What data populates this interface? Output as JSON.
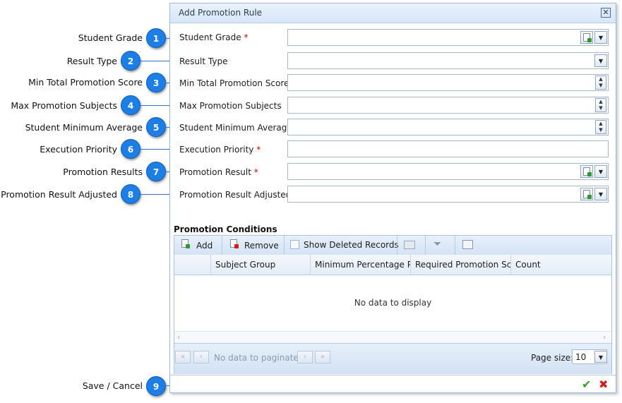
{
  "dialog": {
    "title": "Add Promotion Rule",
    "close_label": "✕"
  },
  "callouts": [
    {
      "num": "1",
      "label": "Student Grade"
    },
    {
      "num": "2",
      "label": "Result  Type"
    },
    {
      "num": "3",
      "label": "Min Total Promotion Score"
    },
    {
      "num": "4",
      "label": "Max Promotion Subjects"
    },
    {
      "num": "5",
      "label": "Student Minimum Average"
    },
    {
      "num": "6",
      "label": "Execution Priority"
    },
    {
      "num": "7",
      "label": "Promotion Results"
    },
    {
      "num": "8",
      "label": "Promotion Result Adjusted"
    },
    {
      "num": "9",
      "label": "Save / Cancel"
    }
  ],
  "fields": [
    {
      "label": "Student Grade",
      "required": "*",
      "value": ""
    },
    {
      "label": "Result Type",
      "required": "",
      "value": ""
    },
    {
      "label": "Min Total Promotion Score",
      "required": "",
      "value": ""
    },
    {
      "label": "Max Promotion Subjects",
      "required": "",
      "value": ""
    },
    {
      "label": "Student Minimum Average",
      "required": "",
      "value": ""
    },
    {
      "label": "Execution Priority",
      "required": "*",
      "value": ""
    },
    {
      "label": "Promotion Result",
      "required": "*",
      "value": ""
    },
    {
      "label": "Promotion Result Adjusted",
      "required": "",
      "value": ""
    }
  ],
  "conditions": {
    "title": "Promotion Conditions",
    "toolbar": {
      "add": "Add",
      "remove": "Remove",
      "show_deleted": "Show Deleted Records"
    },
    "columns": [
      "Subject Group",
      "Minimum Percentage Per",
      "Required Promotion Scor",
      "Count"
    ],
    "empty_text": "No data to display",
    "pager": {
      "text": "No data to paginate",
      "page_size_label": "Page size:",
      "page_size": "10"
    }
  },
  "icons": {
    "new": "new-document-icon",
    "dropdown": "chevron-down-icon",
    "spin": "spin-arrows-icon",
    "save": "checkmark-icon",
    "cancel": "cancel-x-icon"
  },
  "colors": {
    "badge": "#1d7ee6",
    "required": "#d10000",
    "save": "#3a9a2a",
    "cancel": "#d21b1b"
  }
}
